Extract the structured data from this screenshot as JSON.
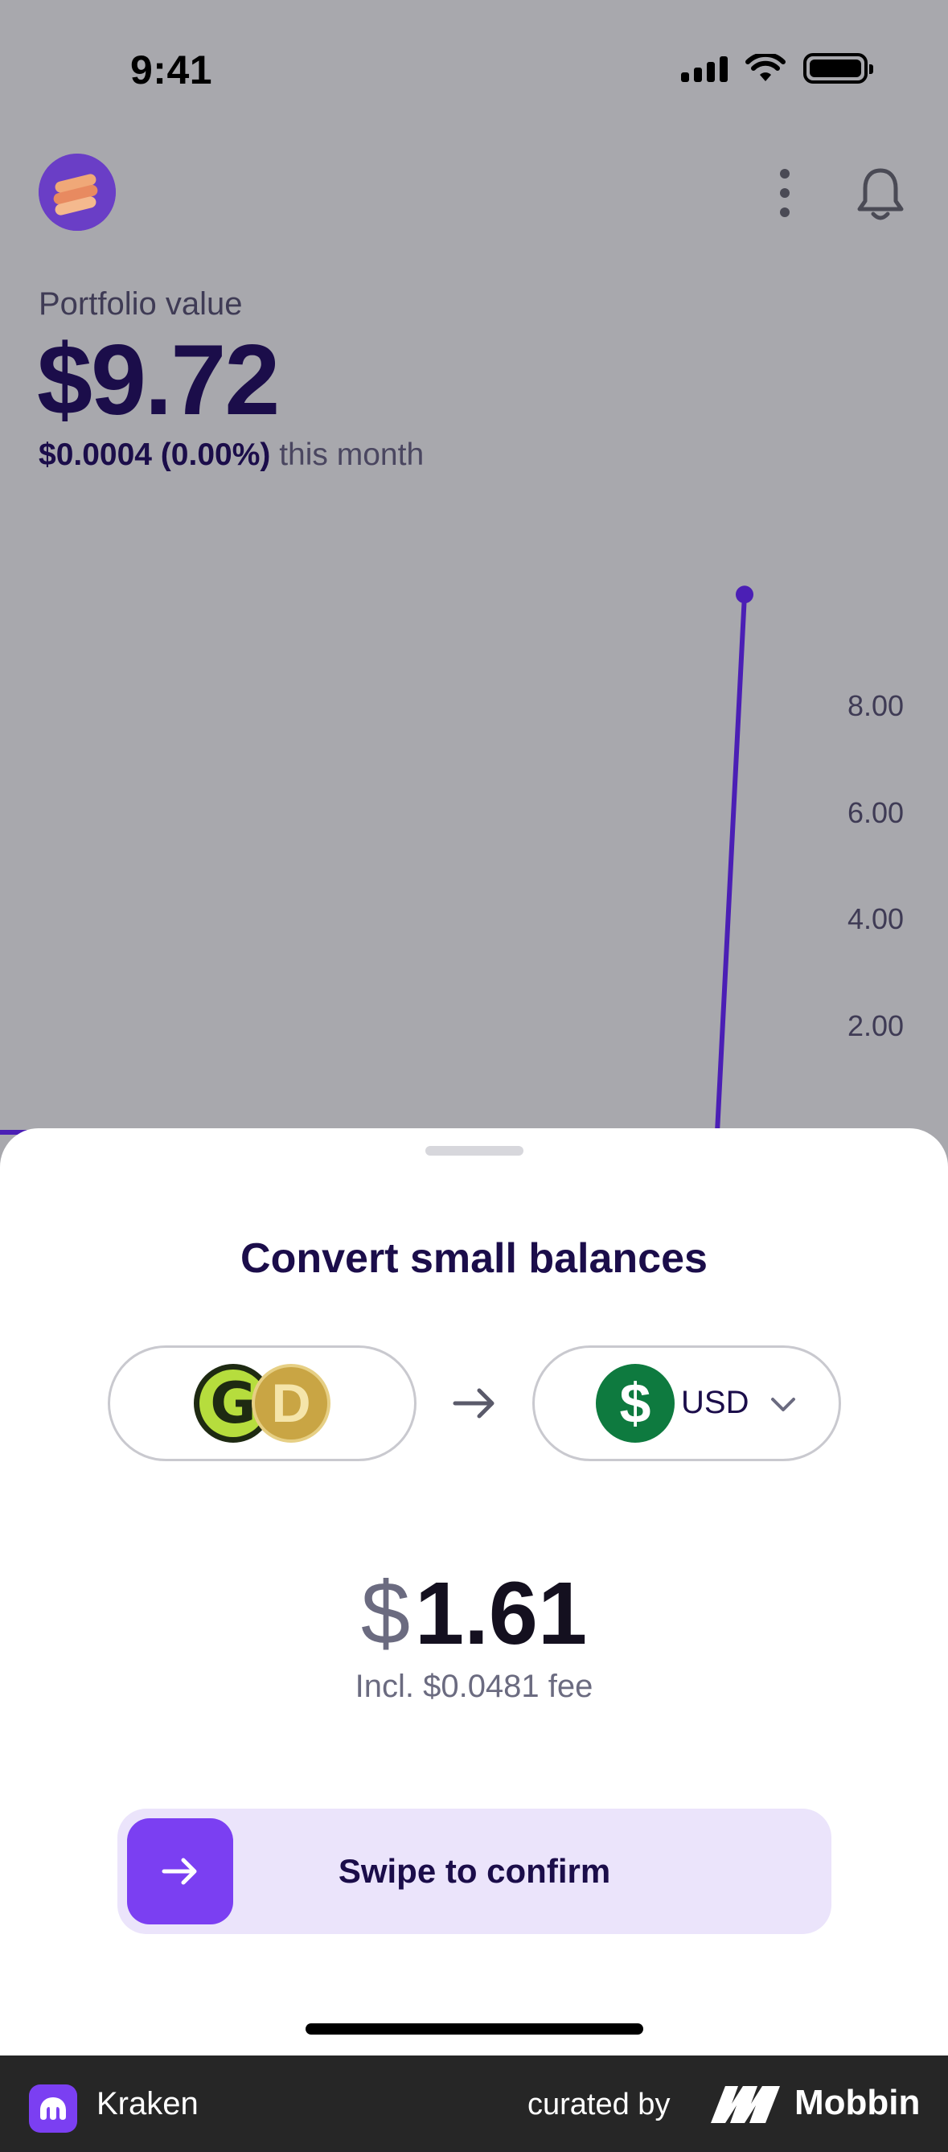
{
  "status_bar": {
    "time": "9:41"
  },
  "portfolio": {
    "label": "Portfolio value",
    "value": "$9.72",
    "change_amount": "$0.0004 (0.00%)",
    "change_suffix": "this month"
  },
  "chart_data": {
    "type": "line",
    "y_ticks": [
      "8.00",
      "6.00",
      "4.00",
      "2.00"
    ],
    "ylim": [
      0,
      10
    ],
    "series": [
      {
        "values": [
          0,
          0,
          9.72
        ]
      }
    ],
    "color": "#4b1fb5"
  },
  "sheet": {
    "title": "Convert small balances",
    "from_coins": [
      "G",
      "D"
    ],
    "to_currency": "USD",
    "to_icon_symbol": "$",
    "amount_symbol": "$",
    "amount_value": "1.61",
    "fee": "Incl. $0.0481 fee",
    "swipe_label": "Swipe to confirm"
  },
  "footer": {
    "app_name": "Kraken",
    "curated_by": "curated by",
    "brand": "Mobbin"
  },
  "colors": {
    "accent": "#7b3ff2",
    "text_primary": "#1b0d4a",
    "usd_green": "#0e7a3f"
  }
}
